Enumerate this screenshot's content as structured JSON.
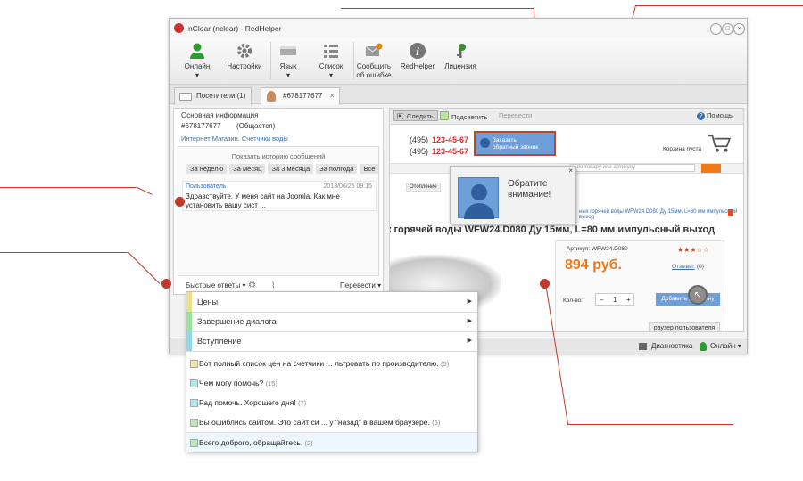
{
  "window": {
    "title": "nClear (nclear) - RedHelper",
    "buttons": [
      "–",
      "□",
      "×"
    ]
  },
  "toolbar": [
    {
      "label": "Онлайн",
      "icon": "user-status-icon",
      "color": "#2e9b2e",
      "arrow": true
    },
    {
      "label": "Настройки",
      "icon": "gear-icon",
      "color": "#777777"
    },
    {
      "label": "Язык",
      "icon": "language-icon",
      "color": "#888888",
      "arrow": true
    },
    {
      "label": "Список",
      "icon": "list-icon",
      "color": "#888888",
      "arrow": true
    },
    {
      "label": "Сообщить\nоб ошибке",
      "icon": "report-error-icon",
      "color": "#888888"
    },
    {
      "label": "RedHelper",
      "icon": "info-icon",
      "color": "#777777"
    },
    {
      "label": "Лицензия",
      "icon": "license-key-icon",
      "color": "#3a8f3a"
    }
  ],
  "tabs": [
    {
      "label": "Посетители (1)",
      "icon": "folder-icon"
    },
    {
      "label": "#678177677",
      "icon": "visitor-icon",
      "close": "×"
    }
  ],
  "visitor": {
    "header": "Основная информация",
    "id": "#678177677",
    "group": "(Общается)",
    "source": "Интернет Магазин. Счетчики воды"
  },
  "history": {
    "title": "Показать историю сообщений",
    "filters": [
      "За неделю",
      "За месяц",
      "За 3 месяца",
      "За полгода",
      "Все"
    ]
  },
  "message": {
    "author": "Пользователь",
    "time": "2013/06/26 09:15",
    "text": "Здравствуйте. У меня сайт на Joomla. Как мне установить вашу сист ..."
  },
  "bottom_bar": {
    "quick_replies": "Быстрые ответы ▾",
    "translate": "Перевести ▾"
  },
  "site_toolbar": {
    "follow": "Следить",
    "highlight": "Подсветить",
    "translate": "Перевести",
    "help": "Помощь"
  },
  "site": {
    "phone1_code": "(495)",
    "phone1": "123-45-67",
    "phone2_code": "(495)",
    "phone2": "123-45-67",
    "callback": "Заказать\nобратный звонок",
    "cart": "Корзина пуста",
    "search_placeholder": "ь по товару или артикулу",
    "crumb1": "Отопление",
    "product_link": "ных горячей воды WFW24.D080 Ду 15мм, L=80 мм импульсный выход",
    "title": "к горячей воды WFW24.D080 Ду 15мм, L=80 мм импульсный выход",
    "article": "Артикул: WFW24.D080",
    "price": "894 руб.",
    "rating_stars": "★★★☆☆",
    "reviews": "Отзывы:",
    "reviews_count": "(0)",
    "qty_label": "Кол-во:",
    "qty": "1",
    "add_to_cart": "Добавить в корзину",
    "browser_label": "раузер пользователя"
  },
  "popup": {
    "text": "Обратите\nвнимание!",
    "close": "×"
  },
  "status": {
    "diagnostics": "Диагностика",
    "online": "Онлайн ▾"
  },
  "quick_menu": {
    "categories": [
      {
        "label": "Цены",
        "color": "#e8e08a"
      },
      {
        "label": "Завершение диалога",
        "color": "#9be09b"
      },
      {
        "label": "Вступление",
        "color": "#8fd8e8"
      }
    ],
    "answers": [
      {
        "text": "Вот полный список цен на счетчики ... льтровать по производителю.",
        "count": "(5)",
        "color": "#f0e8a8"
      },
      {
        "text": "Чем могу помочь?",
        "count": "(15)",
        "color": "#a8e8f0"
      },
      {
        "text": "Рад помочь. Хорошего дня!",
        "count": "(7)",
        "color": "#a8e8f0"
      },
      {
        "text": "Вы ошиблись сайтом. Это сайт си ... у \"назад\" в вашем браузере.",
        "count": "(6)",
        "color": "#b8e8b8"
      },
      {
        "text": "Всего доброго, обращайтесь.",
        "count": "(2)",
        "color": "#b8e8b8",
        "selected": true
      }
    ]
  },
  "colors": {
    "accent_red": "#c0392b",
    "price_orange": "#f07a1a",
    "link_blue": "#3a6fb0",
    "phone_red": "#d32f2f"
  }
}
